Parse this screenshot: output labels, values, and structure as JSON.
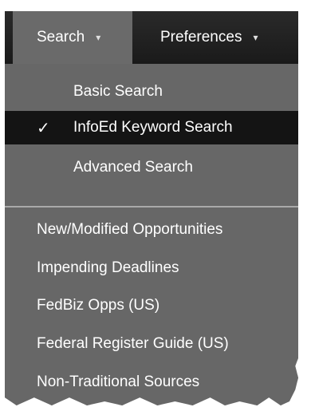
{
  "menubar": {
    "tabs": [
      {
        "label": "Search"
      },
      {
        "label": "Preferences"
      }
    ]
  },
  "search_menu": {
    "modes": [
      {
        "label": "Basic Search"
      },
      {
        "label": "InfoEd Keyword Search",
        "selected": true
      },
      {
        "label": "Advanced Search"
      }
    ],
    "links": [
      {
        "label": "New/Modified Opportunities"
      },
      {
        "label": "Impending Deadlines"
      },
      {
        "label": "FedBiz Opps (US)"
      },
      {
        "label": "Federal Register Guide (US)"
      },
      {
        "label": "Non-Traditional Sources"
      }
    ]
  }
}
